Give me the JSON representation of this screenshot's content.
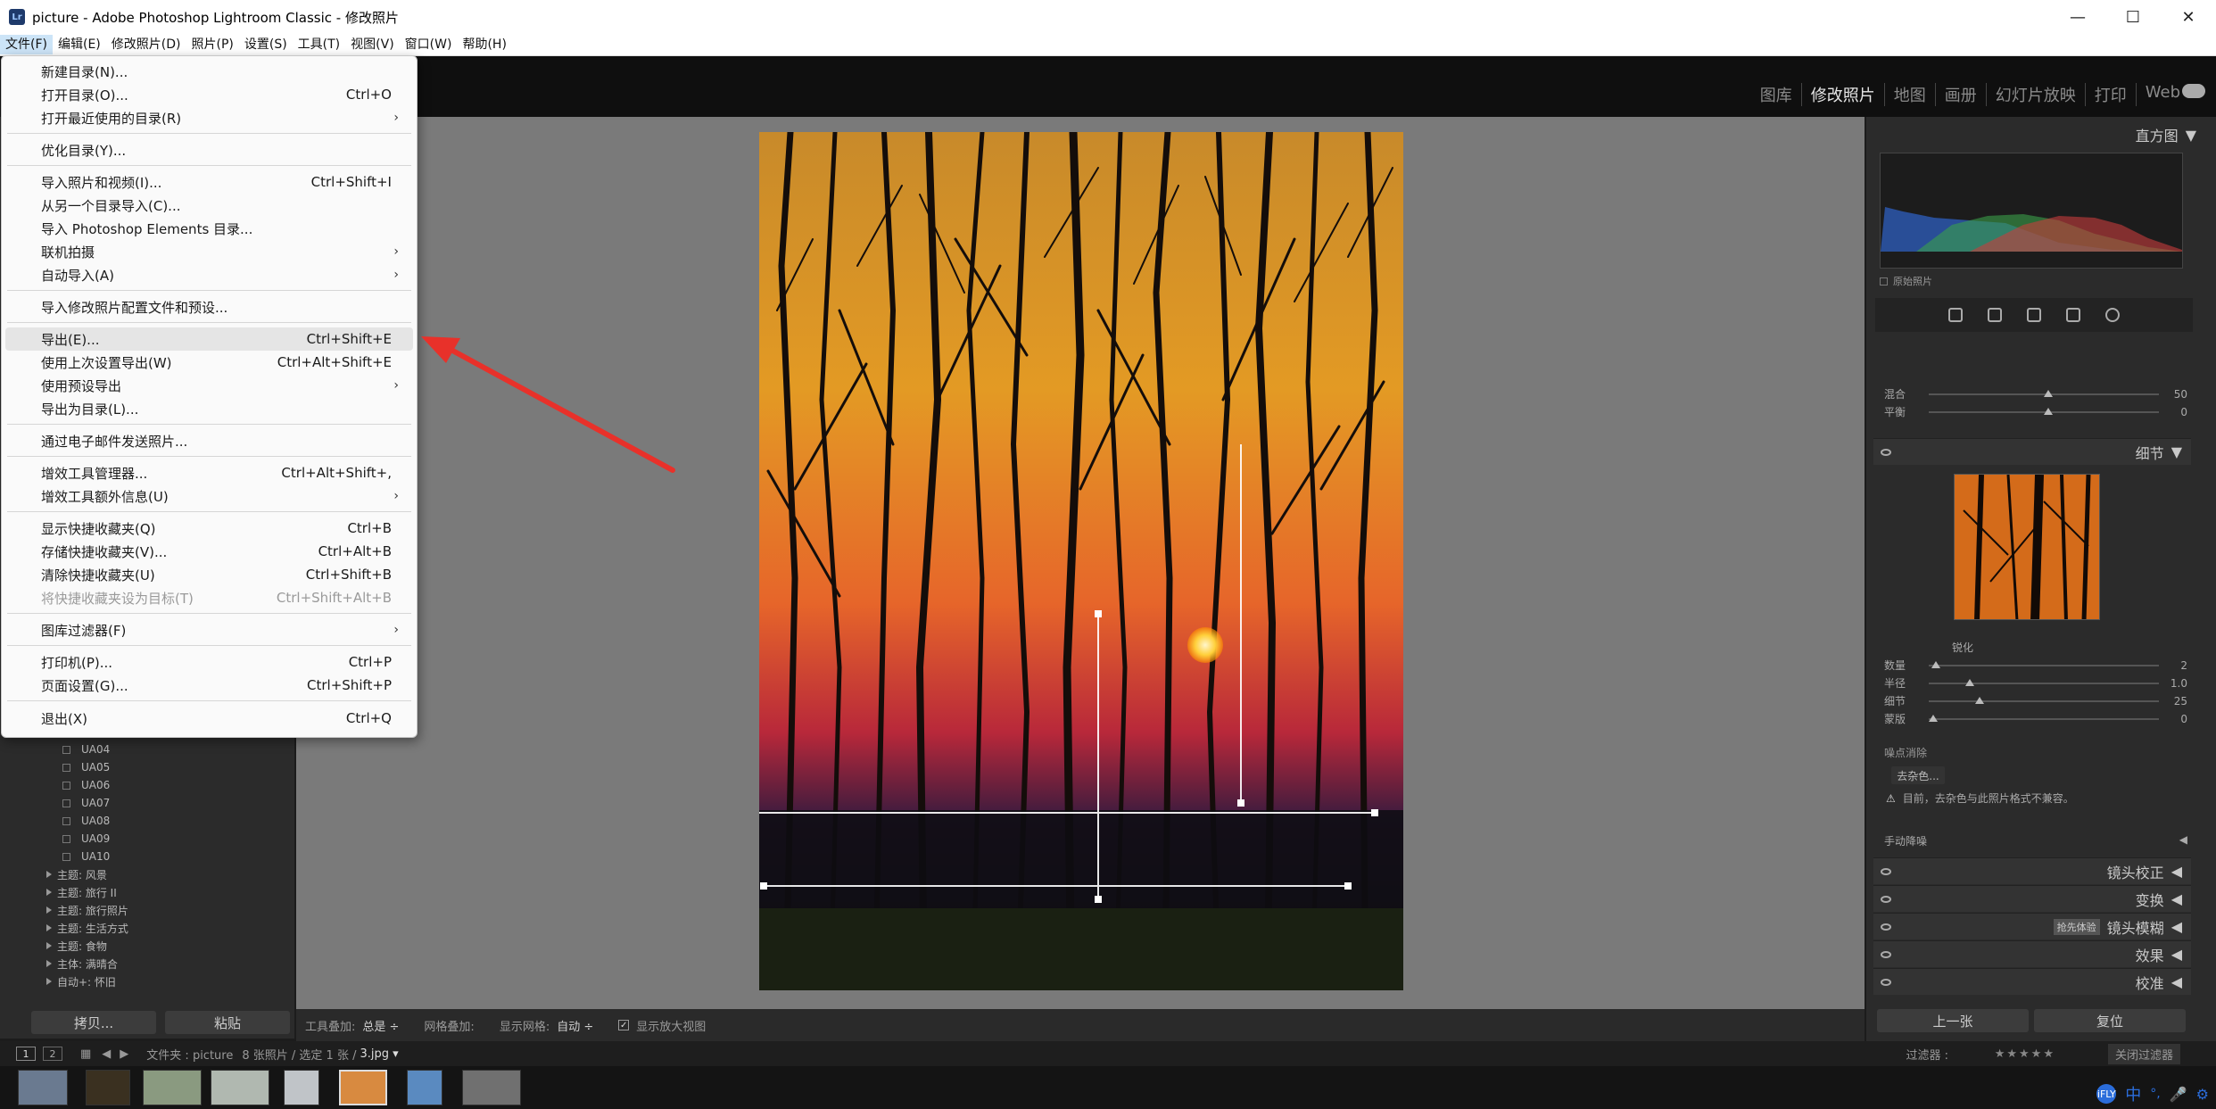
{
  "window": {
    "title": "picture - Adobe Photoshop Lightroom Classic - 修改照片",
    "app_icon_text": "Lr",
    "minimize": "—",
    "maximize": "☐",
    "close": "✕"
  },
  "menubar": [
    "文件(F)",
    "编辑(E)",
    "修改照片(D)",
    "照片(P)",
    "设置(S)",
    "工具(T)",
    "视图(V)",
    "窗口(W)",
    "帮助(H)"
  ],
  "modules": [
    "图库",
    "修改照片",
    "地图",
    "画册",
    "幻灯片放映",
    "打印",
    "Web"
  ],
  "file_menu": {
    "items": [
      {
        "label": "新建目录(N)...",
        "shortcut": "",
        "submenu": false
      },
      {
        "label": "打开目录(O)...",
        "shortcut": "Ctrl+O",
        "submenu": false
      },
      {
        "label": "打开最近使用的目录(R)",
        "shortcut": "",
        "submenu": true
      },
      {
        "label": "优化目录(Y)...",
        "shortcut": "",
        "submenu": false
      },
      {
        "label": "导入照片和视频(I)...",
        "shortcut": "Ctrl+Shift+I",
        "submenu": false
      },
      {
        "label": "从另一个目录导入(C)...",
        "shortcut": "",
        "submenu": false
      },
      {
        "label": "导入 Photoshop Elements 目录...",
        "shortcut": "",
        "submenu": false
      },
      {
        "label": "联机拍摄",
        "shortcut": "",
        "submenu": true
      },
      {
        "label": "自动导入(A)",
        "shortcut": "",
        "submenu": true
      },
      {
        "label": "导入修改照片配置文件和预设...",
        "shortcut": "",
        "submenu": false
      },
      {
        "label": "导出(E)...",
        "shortcut": "Ctrl+Shift+E",
        "submenu": false,
        "highlighted": true
      },
      {
        "label": "使用上次设置导出(W)",
        "shortcut": "Ctrl+Alt+Shift+E",
        "submenu": false
      },
      {
        "label": "使用预设导出",
        "shortcut": "",
        "submenu": true
      },
      {
        "label": "导出为目录(L)...",
        "shortcut": "",
        "submenu": false
      },
      {
        "label": "通过电子邮件发送照片...",
        "shortcut": "",
        "submenu": false
      },
      {
        "label": "增效工具管理器...",
        "shortcut": "Ctrl+Alt+Shift+,",
        "submenu": false
      },
      {
        "label": "增效工具额外信息(U)",
        "shortcut": "",
        "submenu": true
      },
      {
        "label": "显示快捷收藏夹(Q)",
        "shortcut": "Ctrl+B",
        "submenu": false
      },
      {
        "label": "存储快捷收藏夹(V)...",
        "shortcut": "Ctrl+Alt+B",
        "submenu": false
      },
      {
        "label": "清除快捷收藏夹(U)",
        "shortcut": "Ctrl+Shift+B",
        "submenu": false
      },
      {
        "label": "将快捷收藏夹设为目标(T)",
        "shortcut": "Ctrl+Shift+Alt+B",
        "submenu": false,
        "disabled": true
      },
      {
        "label": "图库过滤器(F)",
        "shortcut": "",
        "submenu": true
      },
      {
        "label": "打印机(P)...",
        "shortcut": "Ctrl+P",
        "submenu": false
      },
      {
        "label": "页面设置(G)...",
        "shortcut": "Ctrl+Shift+P",
        "submenu": false
      },
      {
        "label": "退出(X)",
        "shortcut": "Ctrl+Q",
        "submenu": false
      }
    ]
  },
  "collections": {
    "subitems": [
      "UA04",
      "UA05",
      "UA06",
      "UA07",
      "UA08",
      "UA09",
      "UA10"
    ],
    "themes": [
      "主题: 风景",
      "主题: 旅行 II",
      "主题: 旅行照片",
      "主题: 生活方式",
      "主题: 食物",
      "主体: 满晴合",
      "自动+: 怀旧"
    ]
  },
  "left_buttons": {
    "copy": "拷贝...",
    "paste": "粘贴"
  },
  "toolbar": {
    "tool_overlay_label": "工具叠加:",
    "tool_overlay_value": "总是 ÷",
    "grid_overlay_label": "网格叠加:",
    "show_grid_label": "显示网格:",
    "show_grid_value": "自动 ÷",
    "show_loupe_label": "显示放大视图"
  },
  "right_panel": {
    "histogram_title": "直方图",
    "original_photo_label": "原始照片",
    "blend_label": "混合",
    "blend_value": "50",
    "balance_label": "平衡",
    "balance_value": "0",
    "detail_title": "细节",
    "sharpening_title": "锐化",
    "sharpen_sliders": [
      {
        "label": "数量",
        "value": "2"
      },
      {
        "label": "半径",
        "value": "1.0"
      },
      {
        "label": "细节",
        "value": "25"
      },
      {
        "label": "蒙版",
        "value": "0"
      }
    ],
    "noise_reduction_title": "噪点消除",
    "denoise_button": "去杂色...",
    "warning_text": "目前，去杂色与此照片格式不兼容。",
    "manual_denoise": "手动降噪",
    "lens_correction": "镜头校正",
    "transform": "变换",
    "lens_blur": "镜头模糊",
    "early_access": "抢先体验",
    "effects": "效果",
    "calibration": "校准",
    "prev_button": "上一张",
    "reset_button": "复位"
  },
  "filmbar": {
    "page1": "1",
    "page2": "2",
    "folder_label": "文件夹 : picture",
    "count_text": "8 张照片 / 选定 1 张 /",
    "selected_file": "3.jpg ▾",
    "filter_label": "过滤器 :",
    "stars": "★★★★★",
    "close_filter": "关闭过滤器"
  },
  "tray": [
    "iFLY",
    "中",
    "°,",
    "🎤",
    "⚙"
  ],
  "colors": {
    "accent_red": "#e8312a",
    "menu_highlight": "#e5e5e5"
  }
}
